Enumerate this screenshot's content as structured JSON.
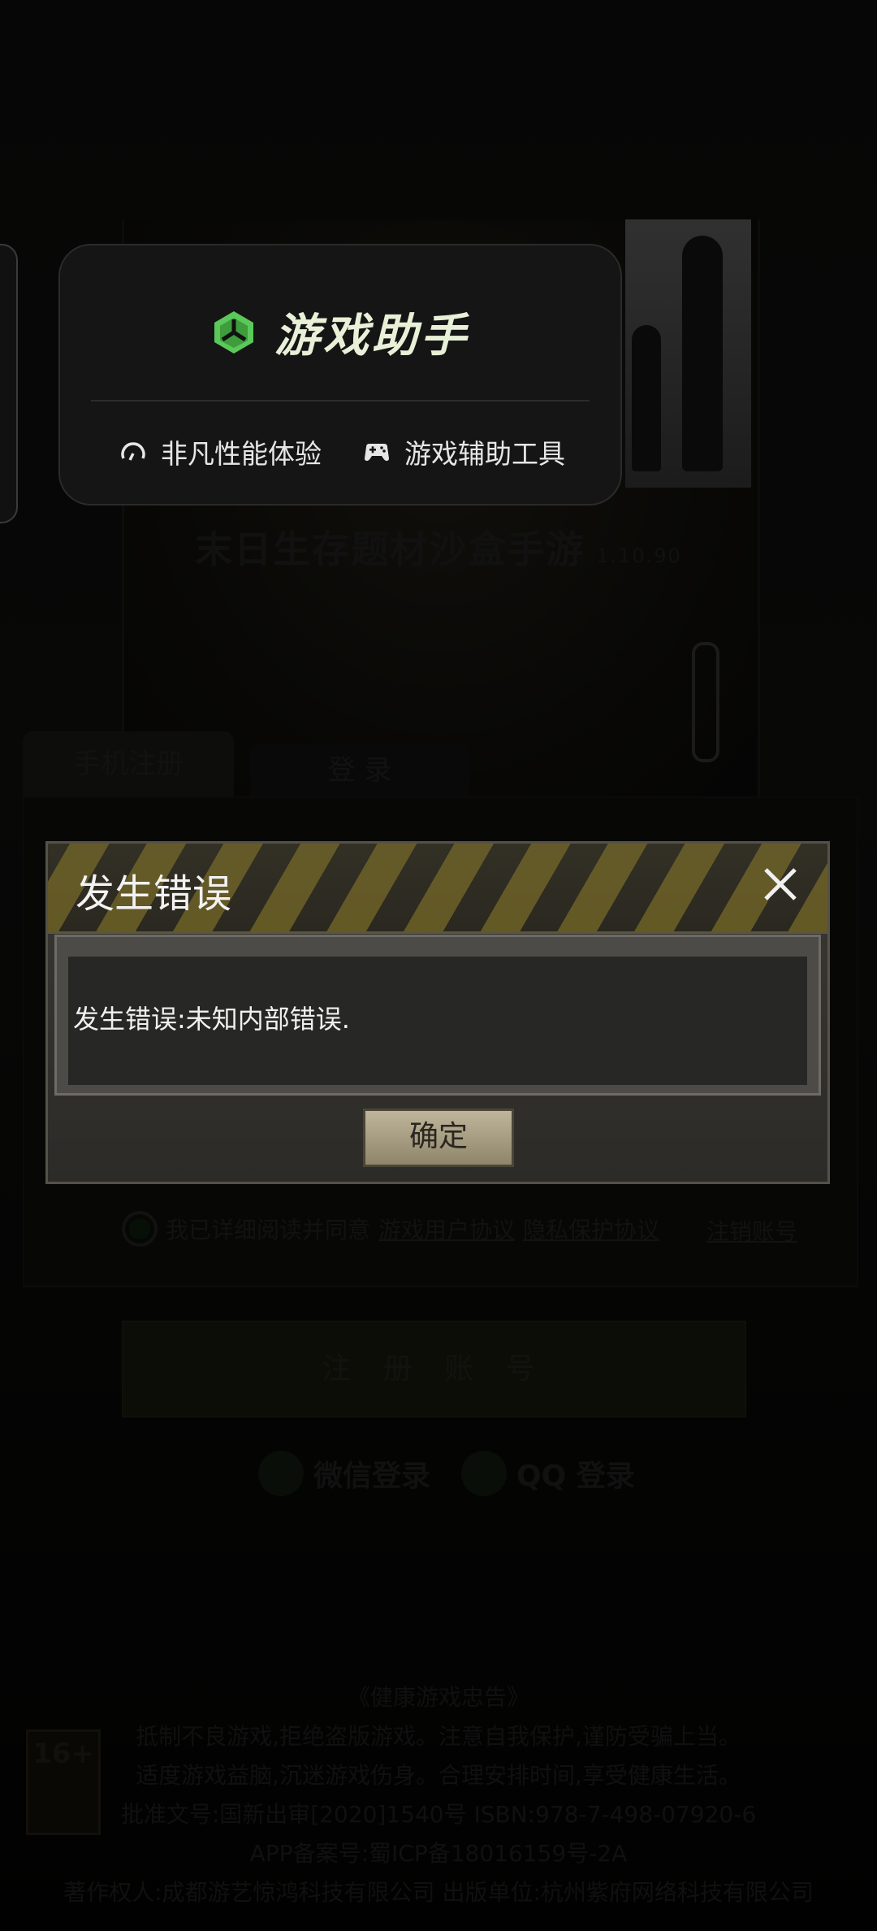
{
  "background": {
    "subtitle": "末日生存题材沙盒手游",
    "version": "1.10.90",
    "tabs": [
      "手机注册",
      "登 录"
    ],
    "agree_prefix": "我已详细阅读并同意",
    "user_agreement": "游戏用户协议",
    "privacy_policy": "隐私保护协议",
    "cancel_account": "注销账号",
    "register_button": "注 册 账 号",
    "wechat_login": "微信登录",
    "qq_login": "QQ 登录",
    "age_badge": "16+",
    "notice_lines": [
      "《健康游戏忠告》",
      "抵制不良游戏,拒绝盗版游戏。注意自我保护,谨防受骗上当。",
      "适度游戏益脑,沉迷游戏伤身。合理安排时间,享受健康生活。",
      "批准文号:国新出审[2020]1540号    ISBN:978-7-498-07920-6",
      "APP备案号:蜀ICP备18016159号-2A",
      "著作权人:成都游艺惊鸿科技有限公司 出版单位:杭州紫府网络科技有限公司"
    ]
  },
  "assistant": {
    "title": "游戏助手",
    "feature_1": "非凡性能体验",
    "feature_2": "游戏辅助工具",
    "accent": "#5bc85a"
  },
  "dialog": {
    "title": "发生错误",
    "message": "发生错误:未知内部错误.",
    "ok": "确定"
  }
}
